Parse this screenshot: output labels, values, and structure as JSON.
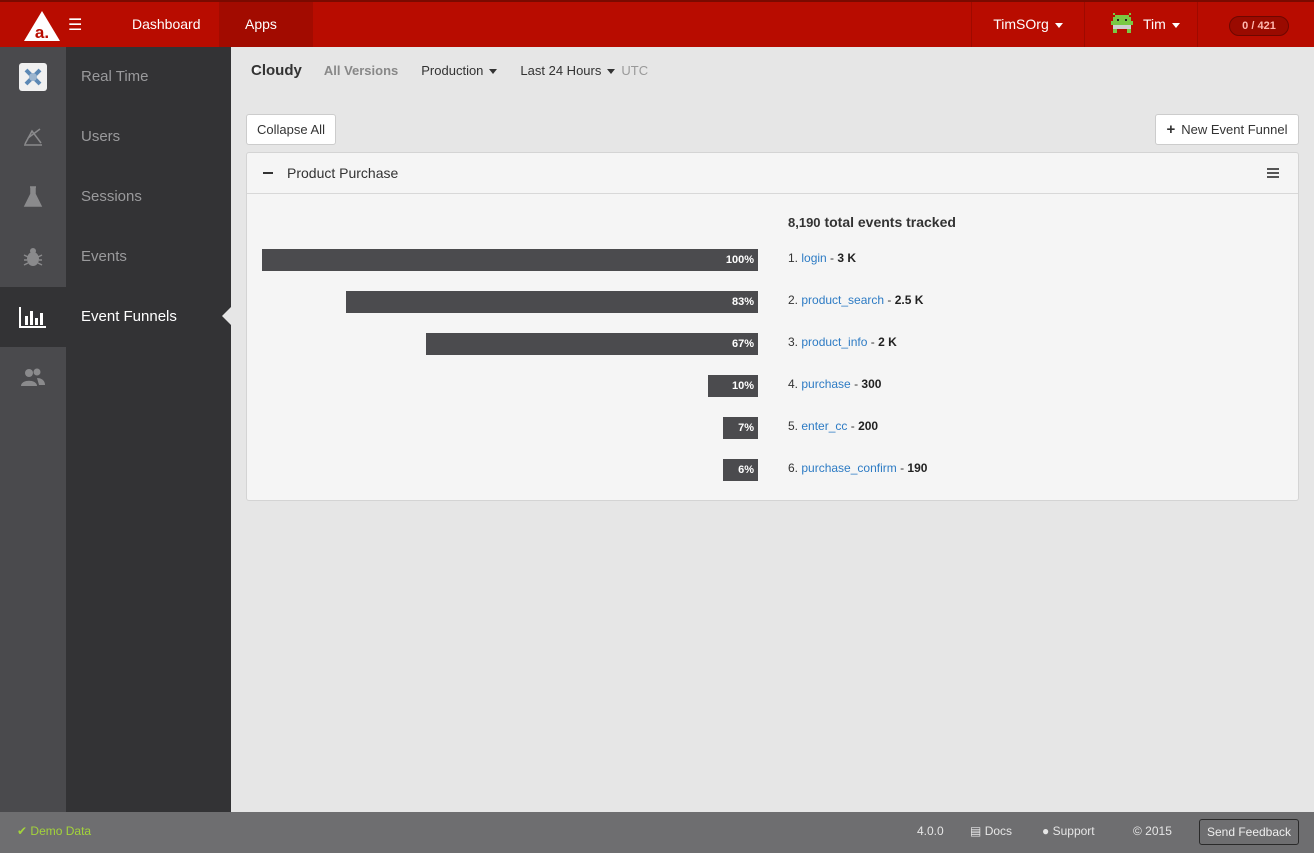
{
  "header": {
    "nav_dashboard": "Dashboard",
    "nav_apps": "Apps",
    "org": "TimSOrg",
    "user": "Tim",
    "counter": "0 / 421"
  },
  "sidebar": {
    "items": [
      {
        "label": "Real Time",
        "icon": "realtime-icon",
        "active": false
      },
      {
        "label": "Users",
        "icon": "users-icon",
        "active": false
      },
      {
        "label": "Sessions",
        "icon": "flask-icon",
        "active": false
      },
      {
        "label": "Events",
        "icon": "bug-icon",
        "active": false
      },
      {
        "label": "Event Funnels",
        "icon": "bar-chart-icon",
        "active": true
      },
      {
        "label": "",
        "icon": "people-icon",
        "active": false
      }
    ]
  },
  "subheader": {
    "app_name": "Cloudy",
    "versions": "All Versions",
    "environment": "Production",
    "range": "Last 24 Hours",
    "timezone": "UTC"
  },
  "toolbar": {
    "collapse_all": "Collapse All",
    "new_funnel": "New Event Funnel"
  },
  "funnel": {
    "title": "Product Purchase",
    "total_number": "8,190",
    "total_label": "total events tracked",
    "steps": [
      {
        "index": "1.",
        "name": "login",
        "count": "3 K",
        "percent_label": "100%"
      },
      {
        "index": "2.",
        "name": "product_search",
        "count": "2.5 K",
        "percent_label": "83%"
      },
      {
        "index": "3.",
        "name": "product_info",
        "count": "2 K",
        "percent_label": "67%"
      },
      {
        "index": "4.",
        "name": "purchase",
        "count": "300",
        "percent_label": "10%"
      },
      {
        "index": "5.",
        "name": "enter_cc",
        "count": "200",
        "percent_label": "7%"
      },
      {
        "index": "6.",
        "name": "purchase_confirm",
        "count": "190",
        "percent_label": "6%"
      }
    ]
  },
  "footer": {
    "demo": "Demo Data",
    "version": "4.0.0",
    "docs": "Docs",
    "support": "Support",
    "copyright": "© 2015",
    "feedback": "Send Feedback"
  },
  "colors": {
    "brand_red": "#b80c00",
    "bar": "#4b4b4e",
    "link": "#2d7bc4",
    "demo_green": "#a3d33b"
  }
}
